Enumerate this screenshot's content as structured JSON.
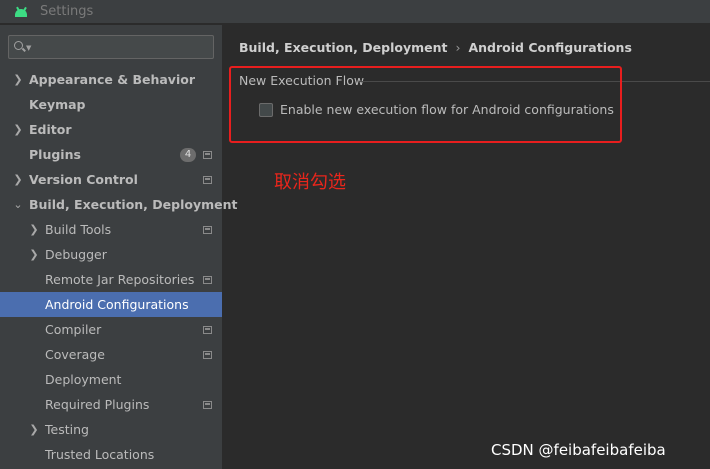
{
  "window": {
    "title": "Settings"
  },
  "search": {
    "value": "",
    "placeholder": ""
  },
  "sidebar": {
    "items": [
      {
        "label": "Appearance & Behavior",
        "expandable": true,
        "expanded": false
      },
      {
        "label": "Keymap",
        "expandable": false
      },
      {
        "label": "Editor",
        "expandable": true,
        "expanded": false
      },
      {
        "label": "Plugins",
        "badge": "4",
        "project_icon": true
      },
      {
        "label": "Version Control",
        "expandable": true,
        "expanded": false,
        "project_icon": true
      },
      {
        "label": "Build, Execution, Deployment",
        "expandable": true,
        "expanded": true
      },
      {
        "label": "Build Tools",
        "expandable": true,
        "project_icon": true
      },
      {
        "label": "Debugger",
        "expandable": true
      },
      {
        "label": "Remote Jar Repositories",
        "project_icon": true
      },
      {
        "label": "Android Configurations",
        "selected": true
      },
      {
        "label": "Compiler",
        "project_icon": true
      },
      {
        "label": "Coverage",
        "project_icon": true
      },
      {
        "label": "Deployment"
      },
      {
        "label": "Required Plugins",
        "project_icon": true
      },
      {
        "label": "Testing",
        "expandable": true
      },
      {
        "label": "Trusted Locations"
      }
    ]
  },
  "main": {
    "breadcrumb": [
      "Build, Execution, Deployment",
      "Android Configurations"
    ],
    "breadcrumb_separator": "›",
    "group_title": "New Execution Flow",
    "checkbox": {
      "label": "Enable new execution flow for Android configurations",
      "checked": false
    }
  },
  "annotation": {
    "text": "取消勾选",
    "color": "#e8261c"
  },
  "watermark": {
    "text": "CSDN @feibafeibafeiba"
  },
  "colors": {
    "selection": "#4b6eaf",
    "sidebar_bg": "#3c3f41",
    "content_bg": "#2b2b2b",
    "highlight_box": "#e81e1e"
  }
}
